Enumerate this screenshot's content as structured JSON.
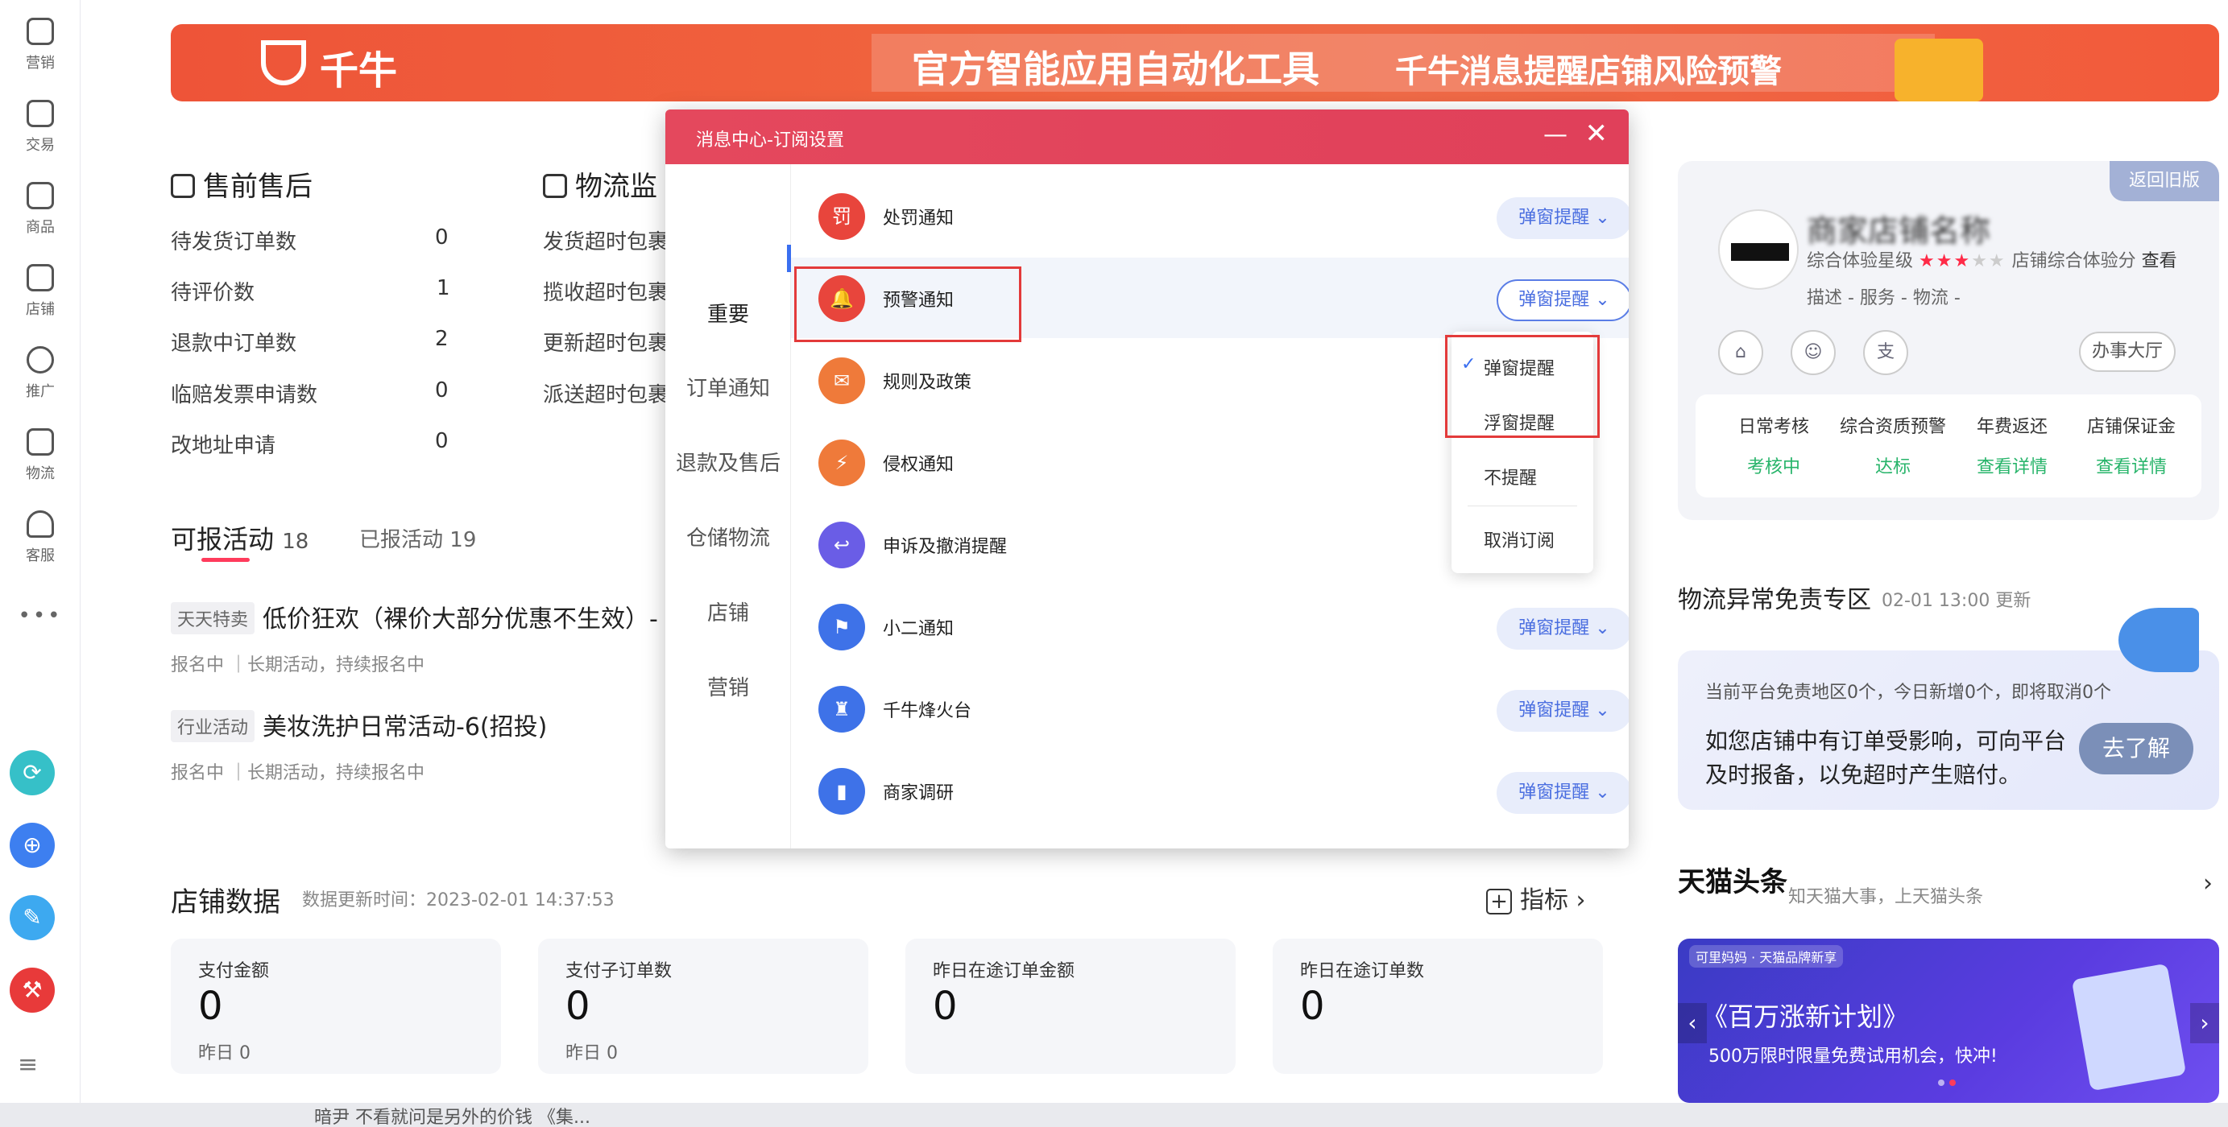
{
  "rail": {
    "items": [
      {
        "label": "营销",
        "icon": "megaphone-icon"
      },
      {
        "label": "交易",
        "icon": "document-icon"
      },
      {
        "label": "商品",
        "icon": "bag-icon"
      },
      {
        "label": "店铺",
        "icon": "store-icon"
      },
      {
        "label": "推广",
        "icon": "lightbulb-icon"
      },
      {
        "label": "物流",
        "icon": "truck-icon"
      },
      {
        "label": "客服",
        "icon": "headset-icon"
      }
    ],
    "more": "•••",
    "apps": [
      "⟳",
      "⊕",
      "✎",
      "⚒"
    ],
    "menu": "≡"
  },
  "banner": {
    "brand": "千牛",
    "headline": "官方智能应用自动化工具",
    "subline": "千牛消息提醒店铺风险预警"
  },
  "presale": {
    "title": "售前售后",
    "rows": [
      {
        "label": "待发货订单数",
        "value": "0"
      },
      {
        "label": "待评价数",
        "value": "1"
      },
      {
        "label": "退款中订单数",
        "value": "2"
      },
      {
        "label": "临赔发票申请数",
        "value": "0"
      },
      {
        "label": "改地址申请",
        "value": "0"
      }
    ]
  },
  "logistics_monitor": {
    "title": "物流监",
    "rows": [
      "发货超时包裹",
      "揽收超时包裹",
      "更新超时包裹",
      "派送超时包裹"
    ]
  },
  "activities": {
    "tab_active": "可报活动",
    "tab_active_count": "18",
    "tab_other": "已报活动",
    "tab_other_count": "19",
    "items": [
      {
        "tag": "天天特卖",
        "name": "低价狂欢（裸价大部分优惠不生效）-",
        "sub": "报名中  ｜长期活动，持续报名中"
      },
      {
        "tag": "行业活动",
        "name": "美妆洗护日常活动-6(招投)",
        "sub": "报名中  ｜长期活动，持续报名中"
      }
    ]
  },
  "shop_data": {
    "title": "店铺数据",
    "update_time": "数据更新时间：2023-02-01 14:37:53",
    "indicator": "指标",
    "cards": [
      {
        "name": "支付金额",
        "value": "0",
        "yesterday": "昨日 0"
      },
      {
        "name": "支付子订单数",
        "value": "0",
        "yesterday": "昨日 0"
      },
      {
        "name": "昨日在途订单金额",
        "value": "0",
        "yesterday": ""
      },
      {
        "name": "昨日在途订单数",
        "value": "0",
        "yesterday": ""
      }
    ]
  },
  "shop_panel": {
    "old_version": "返回旧版",
    "shop_name": "商家店铺名称",
    "score_label": "综合体验星级",
    "score_stars_on": "★★★",
    "score_stars_off": "★★",
    "score_total": "店铺综合体验分",
    "view": "查看",
    "desc": "描述 -   服务 -   物流 -",
    "hall": "办事大厅",
    "checks": [
      {
        "label": "日常考核",
        "status": "考核中"
      },
      {
        "label": "综合资质预警",
        "status": "达标"
      },
      {
        "label": "年费返还",
        "status": "查看详情"
      },
      {
        "label": "店铺保证金",
        "status": "查看详情"
      }
    ]
  },
  "logistics_zone": {
    "title": "物流异常免责专区",
    "time": "02-01 13:00 更新",
    "line1": "当前平台免责地区0个，今日新增0个，即将取消0个",
    "line2": "如您店铺中有订单受影响，可向平台及时报备，以免超时产生赔付。",
    "button": "去了解"
  },
  "tmall_news": {
    "logo": "天猫头条",
    "sub": "知天猫大事，上天猫头条",
    "arrow": "›",
    "promo_tag": "可里妈妈 · 天猫品牌新享",
    "promo_title": "《百万涨新计划》",
    "promo_sub": "500万限时限量免费试用机会，快冲!"
  },
  "bottom": {
    "text": "暗尹 不看就问是另外的价钱 《集..."
  },
  "modal": {
    "title": "消息中心-订阅设置",
    "minimize": "—",
    "close": "✕",
    "nav": [
      "重要",
      "订单通知",
      "退款及售后",
      "仓储物流",
      "店铺",
      "营销"
    ],
    "rows": [
      {
        "label": "处罚通知",
        "pill": "弹窗提醒 ⌄",
        "icon": "penalty-icon",
        "glyph": "罚",
        "color": "#e8453c"
      },
      {
        "label": "预警通知",
        "pill": "弹窗提醒 ⌄",
        "icon": "bell-icon",
        "glyph": "🔔",
        "color": "#e8453c"
      },
      {
        "label": "规则及政策",
        "pill": "",
        "icon": "rules-icon",
        "glyph": "✉",
        "color": "#ef7a3a"
      },
      {
        "label": "侵权通知",
        "pill": "",
        "icon": "shield-icon",
        "glyph": "⚡",
        "color": "#ef7a3a"
      },
      {
        "label": "申诉及撤消提醒",
        "pill": "",
        "icon": "appeal-icon",
        "glyph": "↩",
        "color": "#6a5de6"
      },
      {
        "label": "小二通知",
        "pill": "弹窗提醒 ⌄",
        "icon": "flag-icon",
        "glyph": "⚑",
        "color": "#3e72e8"
      },
      {
        "label": "千牛烽火台",
        "pill": "弹窗提醒 ⌄",
        "icon": "tower-icon",
        "glyph": "♜",
        "color": "#3e72e8"
      },
      {
        "label": "商家调研",
        "pill": "弹窗提醒 ⌄",
        "icon": "chart-icon",
        "glyph": "▮",
        "color": "#3e72e8"
      }
    ],
    "dropdown": [
      {
        "label": "弹窗提醒",
        "checked": "✓"
      },
      {
        "label": "浮窗提醒",
        "checked": ""
      },
      {
        "label": "不提醒",
        "checked": ""
      },
      {
        "label": "取消订阅",
        "checked": ""
      }
    ]
  }
}
